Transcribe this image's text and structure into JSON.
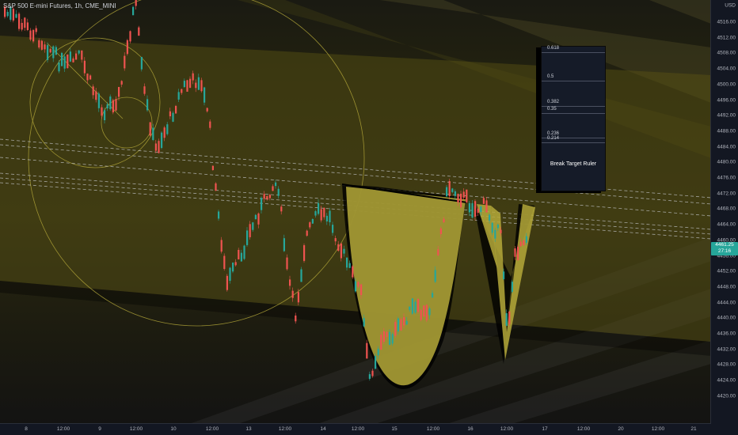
{
  "header": {
    "symbol_title": "S&P 500 E-mini Futures, 1h, CME_MINI"
  },
  "y_axis": {
    "currency_label": "USD",
    "price_ticks": [
      "4516.00",
      "4512.00",
      "4508.00",
      "4504.00",
      "4500.00",
      "4496.00",
      "4492.00",
      "4488.00",
      "4484.00",
      "4480.00",
      "4476.00",
      "4472.00",
      "4468.00",
      "4464.00",
      "4460.00",
      "4456.00",
      "4452.00",
      "4448.00",
      "4444.00",
      "4440.00",
      "4436.00",
      "4432.00",
      "4428.00",
      "4424.00",
      "4420.00"
    ],
    "current_price": "4461.25",
    "countdown": "27:16"
  },
  "x_axis": {
    "time_ticks": [
      "8",
      "12:00",
      "9",
      "12:00",
      "10",
      "12:00",
      "13",
      "12:00",
      "14",
      "12:00",
      "15",
      "12:00",
      "16",
      "12:00",
      "17",
      "12:00",
      "20",
      "12:00",
      "21"
    ]
  },
  "ruler": {
    "title": "Break Target Ruler",
    "levels": [
      "0.618",
      "0.5",
      "0.382",
      "0.35",
      "0.236",
      "0.214"
    ]
  },
  "colors": {
    "bull": "#26a69a",
    "bear": "#ef5350",
    "pattern_fill": "#b5a93a",
    "band": "#6b6418",
    "dashed_lines": "#d1d4dc",
    "badge": "#26a69a"
  }
}
